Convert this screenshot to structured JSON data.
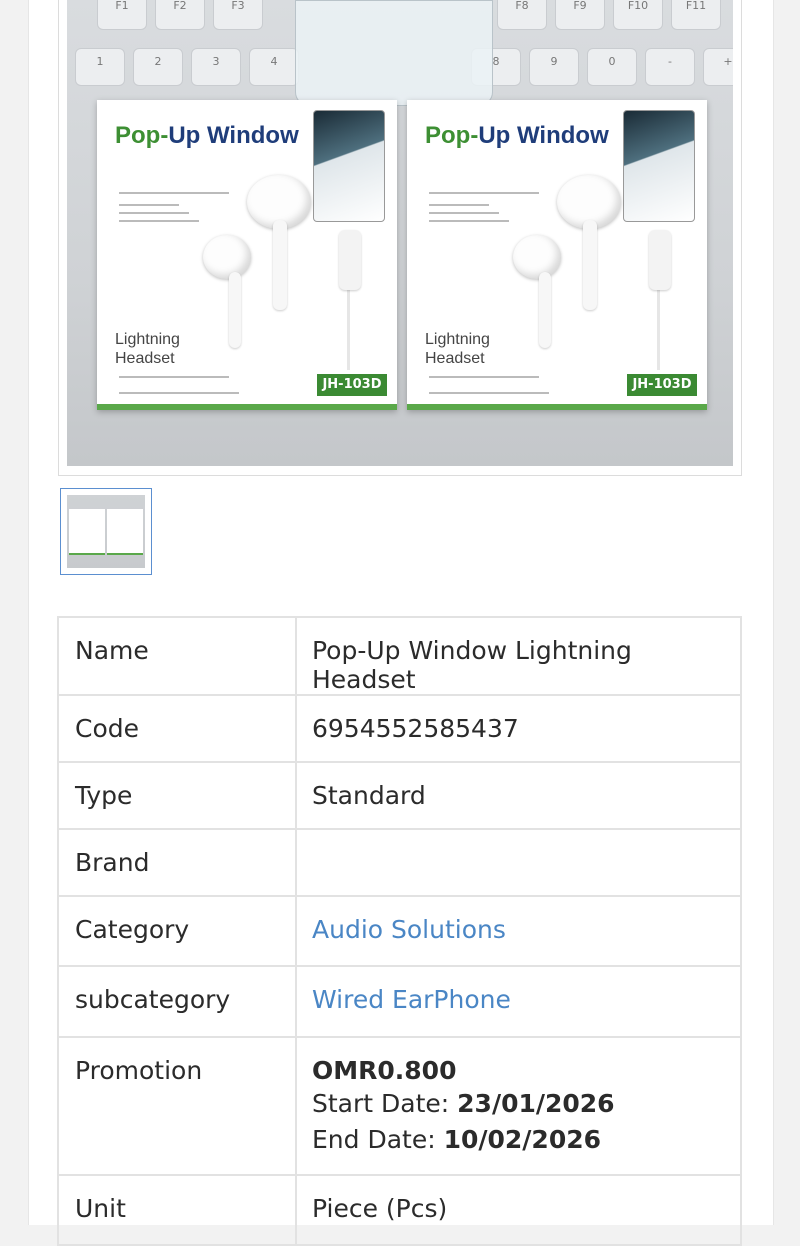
{
  "product_gallery": {
    "main_image": {
      "box_title_left": "Pop-Up Window",
      "box_title_right": "Pop-Up Window",
      "box_subtitle_line1": "Lightning",
      "box_subtitle_line2": "Headset",
      "box_model": "JH-103D",
      "window_label": "Pop-Up Window",
      "keys_row1": [
        "F1",
        "F2",
        "F3",
        "F8",
        "F9",
        "F10",
        "F11"
      ],
      "keys_row2": [
        "1",
        "2",
        "3",
        "4",
        "8",
        "9",
        "0",
        "-",
        "+"
      ]
    },
    "thumbnail_count": 1
  },
  "specs": {
    "rows": [
      {
        "label": "Name",
        "value": "Pop-Up Window Lightning Headset"
      },
      {
        "label": "Code",
        "value": "6954552585437"
      },
      {
        "label": "Type",
        "value": "Standard"
      },
      {
        "label": "Brand",
        "value": ""
      },
      {
        "label": "Category",
        "value": "Audio Solutions",
        "link": true
      },
      {
        "label": "subcategory",
        "value": "Wired EarPhone",
        "link": true
      }
    ],
    "promotion": {
      "label": "Promotion",
      "price": "OMR0.800",
      "start_label": "Start Date: ",
      "start_date": "23/01/2026",
      "end_label": "End Date: ",
      "end_date": "10/02/2026"
    },
    "unit": {
      "label": "Unit",
      "value": "Piece (Pcs)"
    }
  },
  "colors": {
    "link": "#4a86c5",
    "border": "#e2e2e2",
    "thumb_border": "#5b8fd0",
    "box_green": "#3b8a33"
  }
}
